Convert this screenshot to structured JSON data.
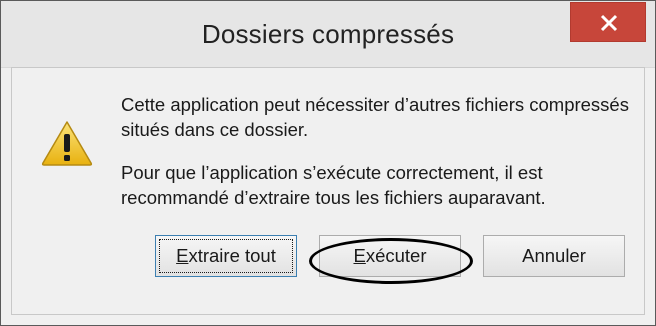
{
  "dialog": {
    "title": "Dossiers compressés",
    "close_glyph": "×",
    "icon": "warning-icon",
    "message_line1": "Cette application peut nécessiter d’autres fichiers compressés situés dans ce dossier.",
    "message_line2": "Pour que l’application s’exécute correctement, il est recommandé d’extraire tous les fichiers auparavant."
  },
  "buttons": {
    "extract": {
      "mnemonic": "E",
      "rest": "xtraire tout"
    },
    "run": {
      "mnemonic": "E",
      "rest": "xécuter",
      "prefix": ""
    },
    "cancel": {
      "label": "Annuler"
    }
  },
  "colors": {
    "close_button": "#c7463a",
    "warning_fill": "#f2c81b",
    "annotation": "#000000"
  }
}
